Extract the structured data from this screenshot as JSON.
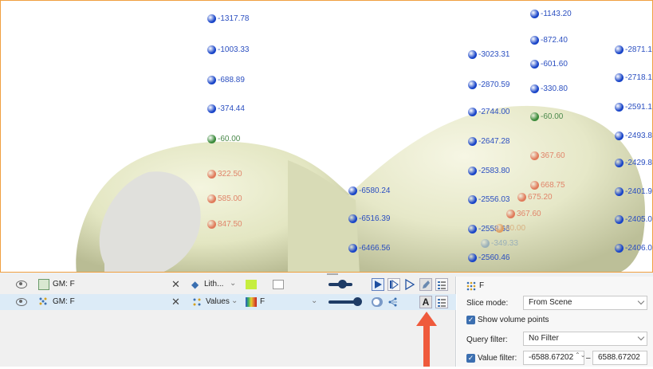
{
  "scene": {
    "points": [
      {
        "label": "-1317.78",
        "color": "#1844c8",
        "text_color": "#2b4fc0"
      },
      {
        "label": "-1003.33",
        "color": "#1844c8",
        "text_color": "#2b4fc0"
      },
      {
        "label": "-688.89",
        "color": "#1844c8",
        "text_color": "#2b4fc0"
      },
      {
        "label": "-374.44",
        "color": "#1844c8",
        "text_color": "#2b4fc0"
      },
      {
        "label": "-60.00",
        "color": "#3a8a3a",
        "text_color": "#4c8a4c"
      },
      {
        "label": "322.50",
        "color": "#e07a5a",
        "text_color": "#e0856a"
      },
      {
        "label": "585.00",
        "color": "#e07a5a",
        "text_color": "#e0856a"
      },
      {
        "label": "847.50",
        "color": "#e07a5a",
        "text_color": "#e0856a"
      },
      {
        "label": "-6580.24",
        "color": "#1844c8",
        "text_color": "#2b4fc0"
      },
      {
        "label": "-6516.39",
        "color": "#1844c8",
        "text_color": "#2b4fc0"
      },
      {
        "label": "-6466.56",
        "color": "#1844c8",
        "text_color": "#2b4fc0"
      },
      {
        "label": "-3023.31",
        "color": "#1844c8",
        "text_color": "#2b4fc0"
      },
      {
        "label": "-2870.59",
        "color": "#1844c8",
        "text_color": "#2b4fc0"
      },
      {
        "label": "-2744.00",
        "color": "#1844c8",
        "text_color": "#2b4fc0"
      },
      {
        "label": "-2647.28",
        "color": "#1844c8",
        "text_color": "#2b4fc0"
      },
      {
        "label": "-2583.80",
        "color": "#1844c8",
        "text_color": "#2b4fc0"
      },
      {
        "label": "-2556.03",
        "color": "#1844c8",
        "text_color": "#2b4fc0"
      },
      {
        "label": "-2558.66",
        "color": "#1844c8",
        "text_color": "#2b4fc0"
      },
      {
        "label": "-2560.46",
        "color": "#1844c8",
        "text_color": "#2b4fc0"
      },
      {
        "label": "-1143.20",
        "color": "#1844c8",
        "text_color": "#2b4fc0"
      },
      {
        "label": "-872.40",
        "color": "#1844c8",
        "text_color": "#2b4fc0"
      },
      {
        "label": "-601.60",
        "color": "#1844c8",
        "text_color": "#2b4fc0"
      },
      {
        "label": "-330.80",
        "color": "#1844c8",
        "text_color": "#2b4fc0"
      },
      {
        "label": "-60.00",
        "color": "#3a8a3a",
        "text_color": "#4c8a4c"
      },
      {
        "label": "367.60",
        "color": "#e07a5a",
        "text_color": "#e0856a"
      },
      {
        "label": "668.75",
        "color": "#e07a5a",
        "text_color": "#e0856a"
      },
      {
        "label": "675.20",
        "color": "#e07a5a",
        "text_color": "#e0856a"
      },
      {
        "label": "367.60",
        "color": "#e07a5a",
        "text_color": "#e0856a"
      },
      {
        "label": "60.00",
        "color": "#e0a060",
        "text_color": "#d8b080"
      },
      {
        "label": "-349.33",
        "color": "#9ab0b8",
        "text_color": "#9ab0b8"
      },
      {
        "label": "-2871.1",
        "color": "#1844c8",
        "text_color": "#2b4fc0"
      },
      {
        "label": "-2718.1",
        "color": "#1844c8",
        "text_color": "#2b4fc0"
      },
      {
        "label": "-2591.1",
        "color": "#1844c8",
        "text_color": "#2b4fc0"
      },
      {
        "label": "-2493.8",
        "color": "#1844c8",
        "text_color": "#2b4fc0"
      },
      {
        "label": "-2429.8",
        "color": "#1844c8",
        "text_color": "#2b4fc0"
      },
      {
        "label": "-2401.9",
        "color": "#1844c8",
        "text_color": "#2b4fc0"
      },
      {
        "label": "-2405.0",
        "color": "#1844c8",
        "text_color": "#2b4fc0"
      },
      {
        "label": "-2406.0",
        "color": "#1844c8",
        "text_color": "#2b4fc0"
      }
    ]
  },
  "layers": [
    {
      "name": "GM: F",
      "icon": "geological-model-icon",
      "style_label": "Lith...",
      "color": "#c6ee3e"
    },
    {
      "name": "GM: F",
      "icon": "points-icon",
      "style_label": "Values",
      "colormap_label": "F"
    }
  ],
  "properties": {
    "title": "F",
    "slice_mode_label": "Slice mode:",
    "slice_mode_value": "From Scene",
    "show_volume_points_label": "Show volume points",
    "query_filter_label": "Query filter:",
    "query_filter_value": "No Filter",
    "value_filter_label": "Value filter:",
    "value_filter_min": "-6588.67202",
    "value_filter_max": "6588.67202",
    "range_sep": "–"
  },
  "colors": {
    "accent_border": "#f0a040",
    "selection": "#dcebf7",
    "arrow": "#ef5a3c"
  }
}
